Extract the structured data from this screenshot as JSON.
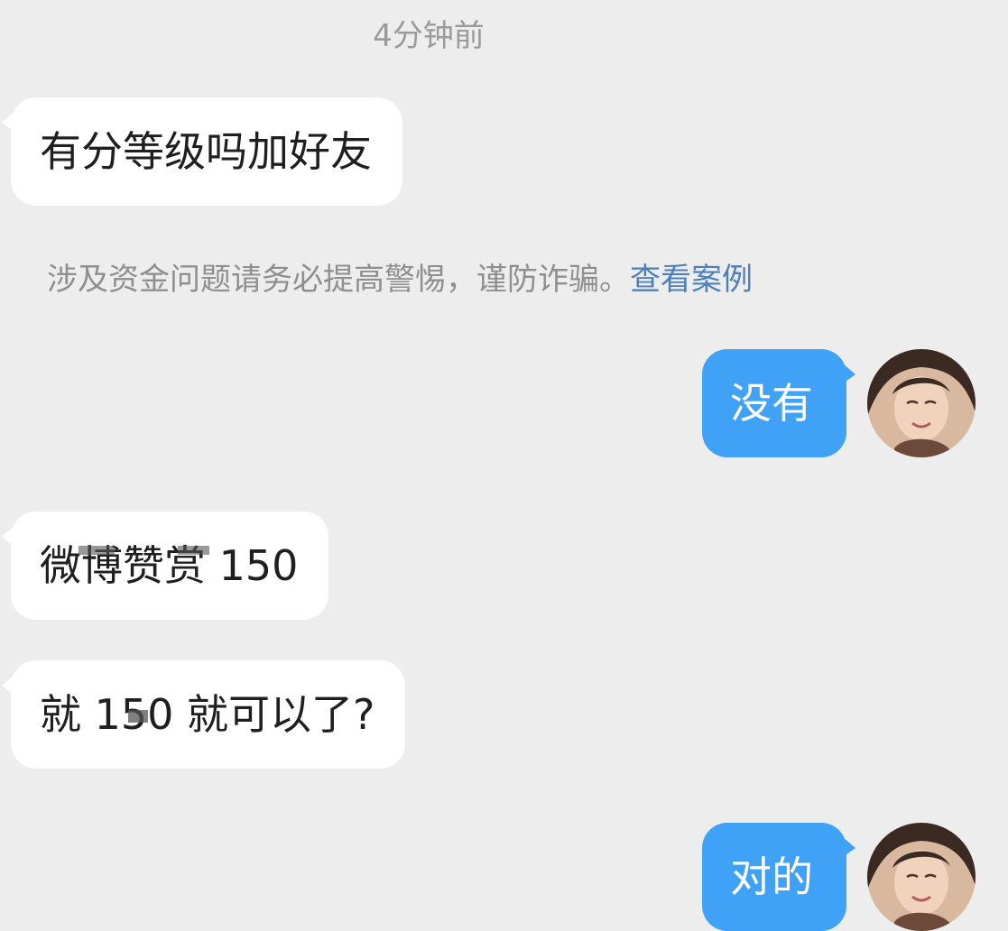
{
  "timestamp": "4分钟前",
  "messages": [
    {
      "side": "left",
      "text": "有分等级吗加好友"
    },
    {
      "side": "right",
      "text": "没有",
      "avatar": "user-avatar-photo"
    },
    {
      "side": "left",
      "text": "微博赞赏 150"
    },
    {
      "side": "left",
      "text": "就 150 就可以了?"
    },
    {
      "side": "right",
      "text": "对的",
      "avatar": "user-avatar-photo"
    }
  ],
  "safety_notice": {
    "text": "涉及资金问题请务必提高警惕，谨防诈骗。",
    "link": "查看案例"
  },
  "colors": {
    "background": "#ededed",
    "incoming_bubble": "#ffffff",
    "outgoing_bubble": "#3fa2f7",
    "link": "#4f7fb8"
  }
}
